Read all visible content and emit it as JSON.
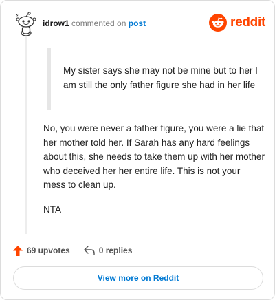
{
  "header": {
    "username": "idrow1",
    "action_text": "commented on",
    "post_link": "post",
    "brand_word": "reddit",
    "brand_color": "#ff4500",
    "link_color": "#0079d3"
  },
  "comment": {
    "quote": "My sister says she may not be mine but to her I am still the only father figure she had in her life",
    "paragraphs": [
      "No, you were never a father figure, you were a lie that her mother told her. If Sarah has any hard feelings about this, she needs to take them up with her mother who deceived her her entire life. This is not your mess to clean up.",
      "NTA"
    ]
  },
  "actions": {
    "upvotes": "69 upvotes",
    "replies": "0 replies",
    "upvote_icon": "upvote-arrow-icon",
    "reply_icon": "reply-arrow-icon"
  },
  "footer": {
    "view_more": "View more on Reddit"
  }
}
